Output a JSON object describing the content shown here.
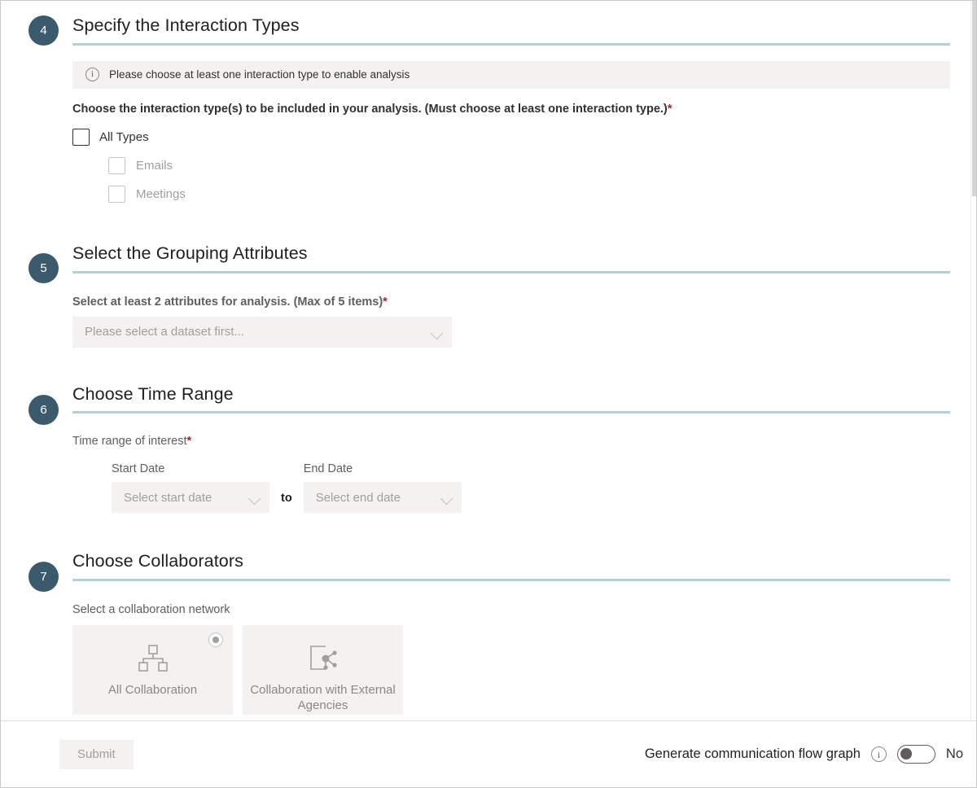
{
  "sections": [
    {
      "number": "4",
      "title": "Specify the Interaction Types",
      "banner": {
        "icon": "info-icon",
        "message": "Please choose at least one interaction type to enable analysis"
      },
      "prompt": "Choose the interaction type(s) to be included in your analysis. (Must choose at least one interaction type.)",
      "required_mark": "*",
      "checkboxes": [
        {
          "label": "All Types",
          "checked": false,
          "disabled": false
        },
        {
          "label": "Emails",
          "checked": false,
          "disabled": true
        },
        {
          "label": "Meetings",
          "checked": false,
          "disabled": true
        }
      ]
    },
    {
      "number": "5",
      "title": "Select the Grouping Attributes",
      "prompt": "Select at least 2 attributes for analysis. (Max of 5 items)",
      "required_mark": "*",
      "select": {
        "value": "Please select a dataset first...",
        "icon": "chevron-down-icon"
      }
    },
    {
      "number": "6",
      "title": "Choose Time Range",
      "prompt": "Time range of interest",
      "required_mark": "*",
      "start": {
        "label": "Start Date",
        "value": "Select start date",
        "icon": "chevron-down-icon"
      },
      "separator": "to",
      "end": {
        "label": "End Date",
        "value": "Select end date",
        "icon": "chevron-down-icon"
      }
    },
    {
      "number": "7",
      "title": "Choose Collaborators",
      "prompt": "Select a collaboration network",
      "cards": [
        {
          "label": "All Collaboration",
          "icon": "org-hierarchy-icon",
          "selected": true
        },
        {
          "label": "Collaboration with External Agencies",
          "icon": "external-network-icon",
          "selected": false
        }
      ]
    }
  ],
  "footer": {
    "submit_label": "Submit",
    "toggle_label": "Generate communication flow graph",
    "toggle_info_icon": "info-icon",
    "toggle_state": "No",
    "toggle_on": false
  },
  "colors": {
    "badge": "#3b5a6b",
    "rule": "#b3d0d8",
    "required": "#a4262c",
    "banner_bg": "#f3f2f1",
    "field_bg": "#f3f2f1"
  }
}
